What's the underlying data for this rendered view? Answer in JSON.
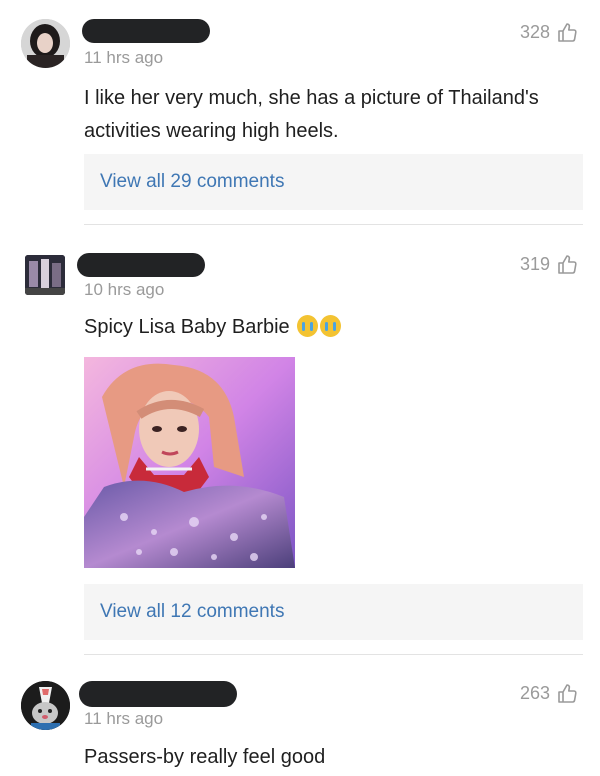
{
  "comments": [
    {
      "time": "11 hrs ago",
      "likes": "328",
      "text": "I like her very much, she has a picture of Thailand's activities wearing high heels.",
      "replies_link": "View all 29 comments"
    },
    {
      "time": "10 hrs ago",
      "likes": "319",
      "text": "Spicy Lisa Baby Barbie",
      "emojis": [
        "crying-face-emoji",
        "crying-face-emoji"
      ],
      "replies_link": "View all 12 comments"
    },
    {
      "time": "11 hrs ago",
      "likes": "263",
      "text": "Passers-by really feel good"
    }
  ],
  "colors": {
    "link": "#3f77b4",
    "meta": "#9a9a9a",
    "redaction": "#222325",
    "reply_box": "#f5f5f5"
  }
}
